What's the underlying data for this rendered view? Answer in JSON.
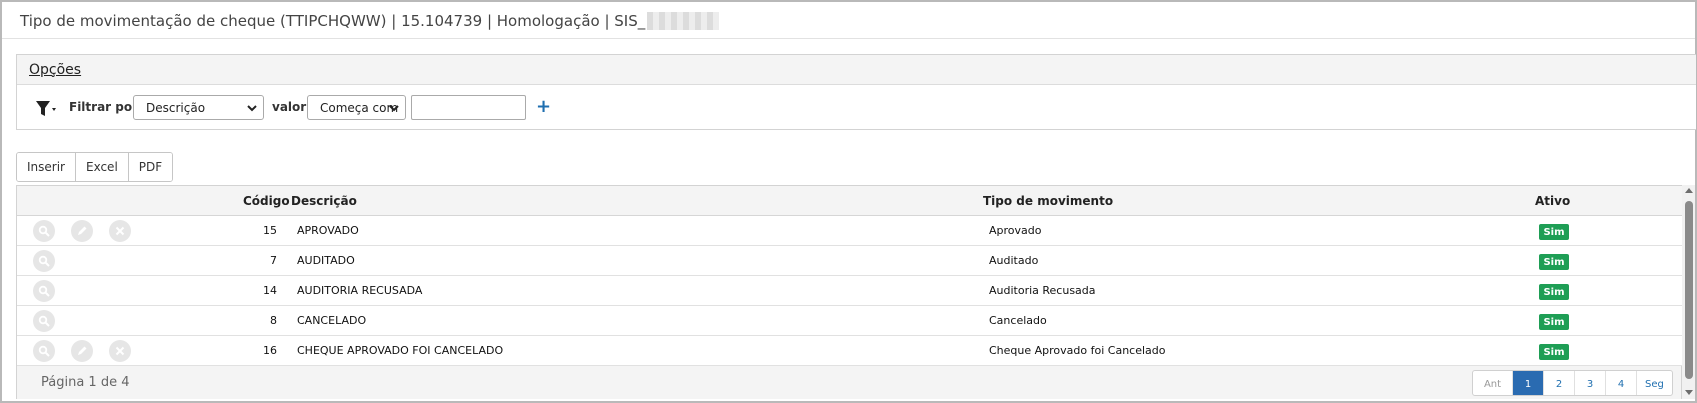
{
  "window": {
    "title": "Tipo de movimentação de cheque (TTIPCHQWW) | 15.104739 | Homologação | SIS_"
  },
  "options_panel": {
    "title": "Opções",
    "filter_label": "Filtrar por",
    "filter_field": "Descrição",
    "value_label": "valor",
    "operator": "Começa com",
    "value_input": "",
    "add_symbol": "+"
  },
  "toolbar": {
    "insert_label": "Inserir",
    "excel_label": "Excel",
    "pdf_label": "PDF"
  },
  "grid": {
    "columns": {
      "code": "Código",
      "description": "Descrição",
      "type": "Tipo de movimento",
      "active": "Ativo"
    },
    "rows": [
      {
        "code": "15",
        "description": "APROVADO",
        "type": "Aprovado",
        "active": "Sim",
        "editable": true
      },
      {
        "code": "7",
        "description": "AUDITADO",
        "type": "Auditado",
        "active": "Sim",
        "editable": false
      },
      {
        "code": "14",
        "description": "AUDITORIA RECUSADA",
        "type": "Auditoria Recusada",
        "active": "Sim",
        "editable": false
      },
      {
        "code": "8",
        "description": "CANCELADO",
        "type": "Cancelado",
        "active": "Sim",
        "editable": false
      },
      {
        "code": "16",
        "description": "CHEQUE APROVADO FOI CANCELADO",
        "type": "Cheque Aprovado foi Cancelado",
        "active": "Sim",
        "editable": true
      }
    ]
  },
  "pagination": {
    "info": "Página 1 de 4",
    "prev": "Ant",
    "pages": [
      "1",
      "2",
      "3",
      "4"
    ],
    "current": "1",
    "next": "Seg"
  },
  "colors": {
    "active_badge": "#1e9e55",
    "pager_active": "#2a6bb1",
    "link": "#1f6fb0"
  }
}
